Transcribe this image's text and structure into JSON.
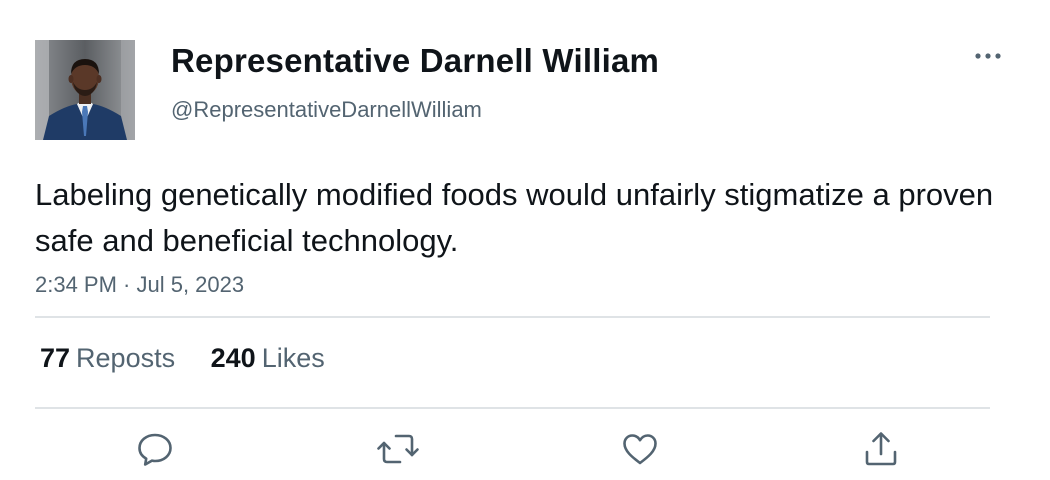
{
  "tweet": {
    "author": {
      "name": "Representative Darnell William",
      "handle": "@RepresentativeDarnellWilliam"
    },
    "text": "Labeling genetically modified foods would unfairly stigmatize a proven safe and beneficial technology.",
    "timestamp": "2:34 PM · Jul 5, 2023",
    "stats": {
      "reposts_count": "77",
      "reposts_label": "Reposts",
      "likes_count": "240",
      "likes_label": "Likes"
    }
  },
  "icons": {
    "more": "more-horizontal-icon",
    "reply": "reply-bubble-icon",
    "repost": "repost-arrows-icon",
    "like": "heart-icon",
    "share": "share-upload-icon"
  },
  "colors": {
    "text_primary": "#0f1419",
    "text_secondary": "#536471",
    "divider": "#dfe3e6",
    "icon": "#536471"
  }
}
